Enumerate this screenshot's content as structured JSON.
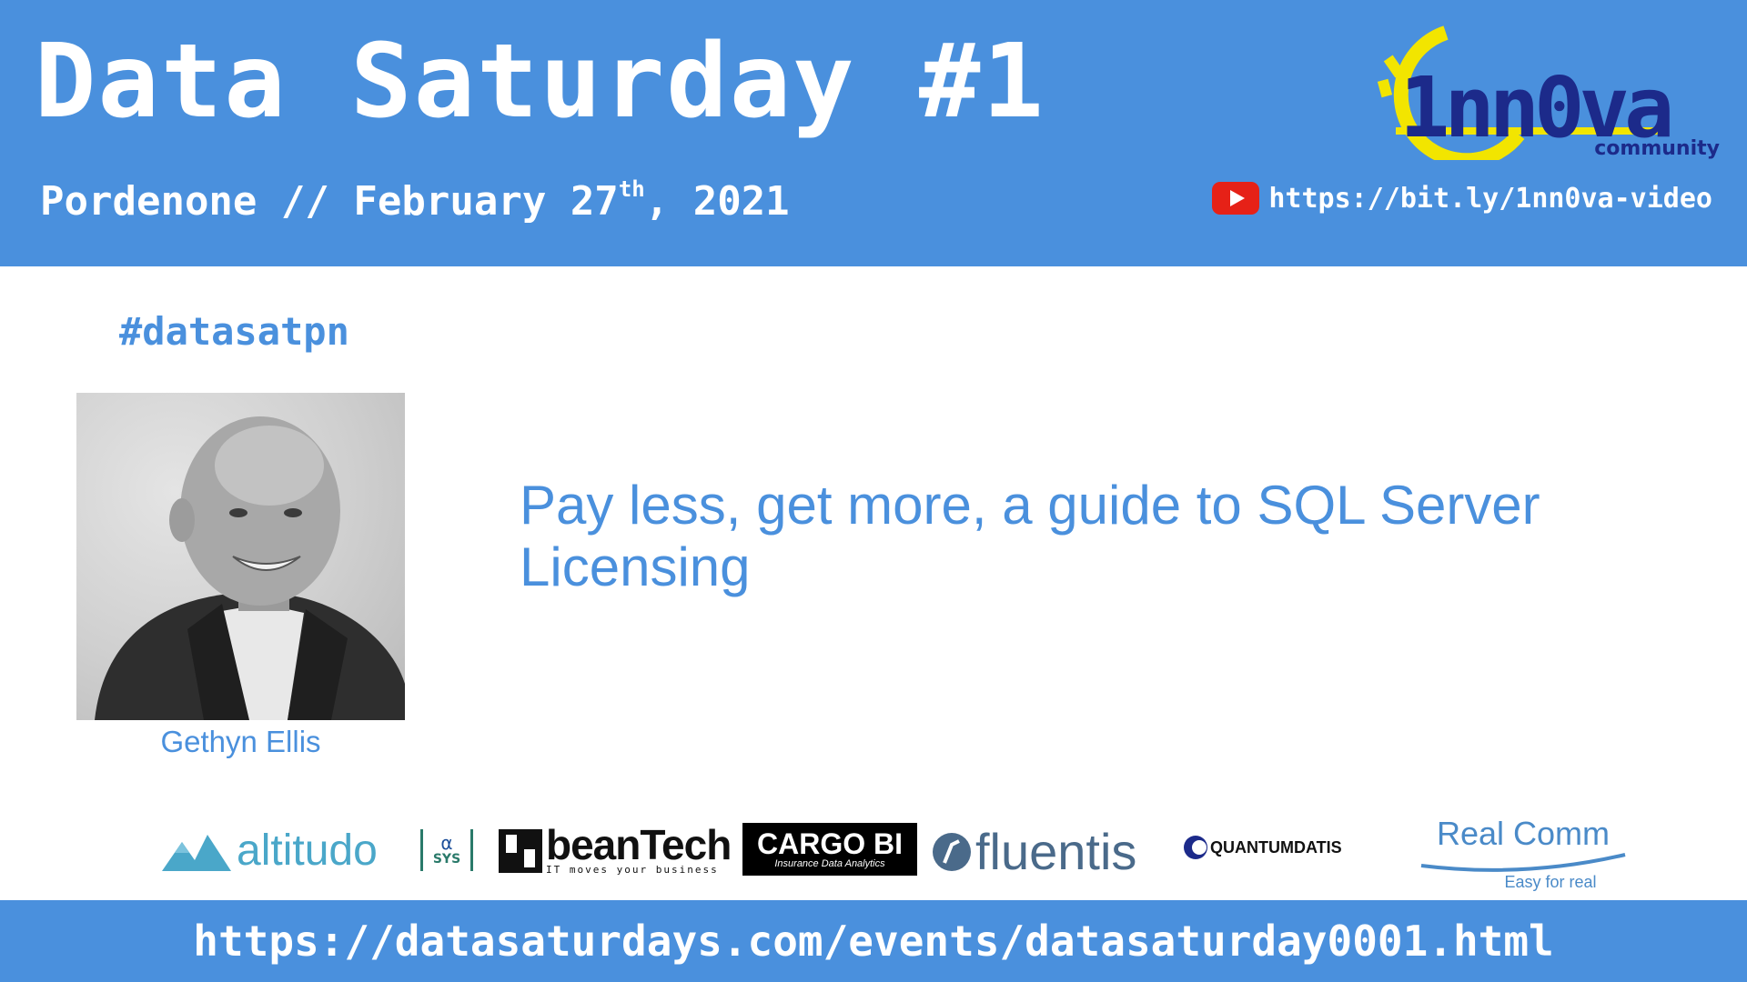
{
  "event": {
    "title": "Data Saturday #1",
    "location": "Pordenone",
    "separator": "//",
    "date_prefix": "February 27",
    "date_suffix": "th",
    "date_year": ", 2021"
  },
  "video": {
    "icon": "youtube-icon",
    "url": "https://bit.ly/1nn0va-video"
  },
  "organizer_logo": {
    "name": "1nn0va",
    "tagline": "community",
    "colors": {
      "ring": "#f2e500",
      "text": "#1c2a8a"
    }
  },
  "hashtag": "#datasatpn",
  "speaker": {
    "name": "Gethyn Ellis",
    "photo": "speaker-photo"
  },
  "session": {
    "title": "Pay less, get more, a guide to SQL Server Licensing"
  },
  "sponsors": [
    {
      "name": "altitudo",
      "text": "altitudo"
    },
    {
      "name": "asys",
      "text_top": "α",
      "text_bottom": "SYS"
    },
    {
      "name": "beanTech",
      "text": "beanTech",
      "tagline": "IT moves your business"
    },
    {
      "name": "CARGO BI",
      "text": "CARGO BI",
      "tagline": "Insurance Data Analytics"
    },
    {
      "name": "fluentis",
      "text": "fluentis"
    },
    {
      "name": "QUANTUMDATIS",
      "text": "QUANTUMDATIS"
    },
    {
      "name": "Real Comm",
      "text": "Real Comm",
      "tagline": "Easy for real"
    }
  ],
  "footer": {
    "url": "https://datasaturdays.com/events/datasaturday0001.html"
  },
  "colors": {
    "brand_blue": "#4a90dd",
    "white": "#ffffff",
    "youtube_red": "#e62117"
  }
}
